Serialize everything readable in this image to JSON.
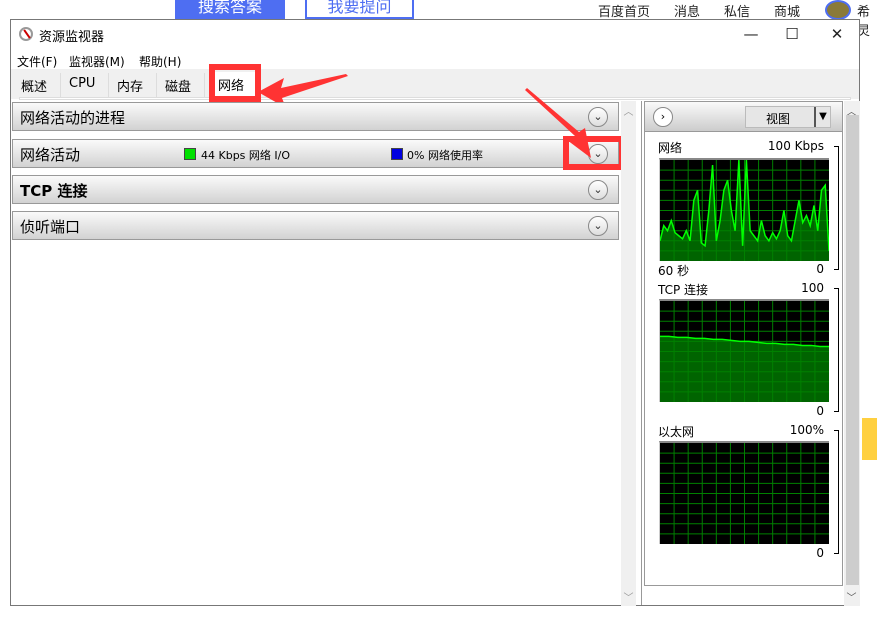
{
  "background_page": {
    "search_button": "搜索答案",
    "ask_button": "我要提问",
    "links": [
      "百度首页",
      "消息",
      "私信",
      "商城"
    ],
    "user_name_partial": "希灵"
  },
  "window": {
    "title": "资源监视器",
    "controls": {
      "minimize": "—",
      "maximize": "☐",
      "close": "✕"
    },
    "menu": [
      "文件(F)",
      "监视器(M)",
      "帮助(H)"
    ],
    "tabs": [
      {
        "label": "概述",
        "active": false
      },
      {
        "label": "CPU",
        "active": false
      },
      {
        "label": "内存",
        "active": false
      },
      {
        "label": "磁盘",
        "active": false
      },
      {
        "label": "网络",
        "active": true
      }
    ],
    "sections": [
      {
        "title": "网络活动的进程"
      },
      {
        "title": "网络活动",
        "legend": [
          {
            "text": "44 Kbps 网络 I/O",
            "color": "#00e000"
          },
          {
            "text": "0% 网络使用率",
            "color": "#0000e0"
          }
        ]
      },
      {
        "title": "TCP 连接"
      },
      {
        "title": "侦听端口"
      }
    ],
    "right_panel": {
      "view_button": "视图",
      "graphs": [
        {
          "title": "网络",
          "max": "100 Kbps",
          "time": "60 秒",
          "min": "0",
          "values": [
            20,
            35,
            30,
            40,
            28,
            25,
            22,
            30,
            20,
            60,
            70,
            18,
            15,
            50,
            95,
            20,
            40,
            70,
            80,
            50,
            30,
            100,
            15,
            100,
            30,
            25,
            20,
            40,
            25,
            20,
            28,
            22,
            30,
            50,
            25,
            20,
            40,
            60,
            38,
            45,
            35,
            55,
            30,
            70,
            75,
            10
          ]
        },
        {
          "title": "TCP 连接",
          "max": "100",
          "min": "0",
          "values": [
            65,
            65,
            64,
            64,
            63,
            63,
            62,
            62,
            61,
            60,
            60,
            59,
            58,
            58,
            57,
            57,
            56,
            56,
            55,
            55
          ]
        },
        {
          "title": "以太网",
          "max": "100%",
          "min": "0",
          "values": []
        }
      ]
    }
  },
  "colors": {
    "accent": "#4e6ef2",
    "highlight": "#ff3333",
    "graph_line": "#00ff00",
    "graph_fill": "#006400",
    "graph_grid": "#008000"
  }
}
